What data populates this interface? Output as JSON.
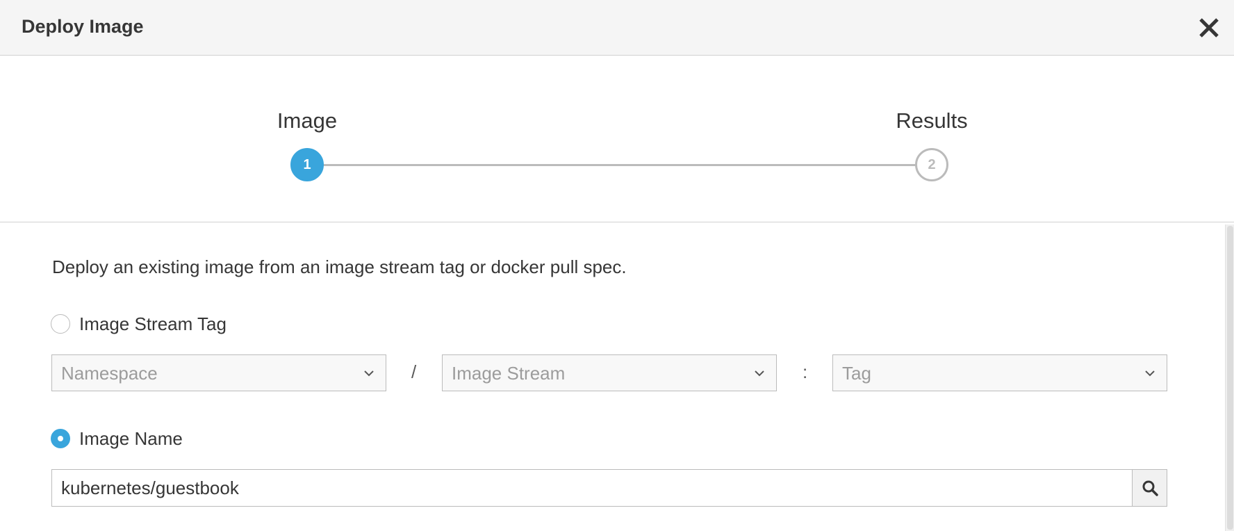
{
  "dialog": {
    "title": "Deploy Image",
    "close_icon": "close-icon"
  },
  "wizard": {
    "steps": [
      {
        "label": "Image",
        "number": "1",
        "state": "active"
      },
      {
        "label": "Results",
        "number": "2",
        "state": "inactive"
      }
    ]
  },
  "form": {
    "intro": "Deploy an existing image from an image stream tag or docker pull spec.",
    "image_stream_tag": {
      "label": "Image Stream Tag",
      "selected": false,
      "namespace_placeholder": "Namespace",
      "separator_slash": "/",
      "image_stream_placeholder": "Image Stream",
      "separator_colon": ":",
      "tag_placeholder": "Tag"
    },
    "image_name": {
      "label": "Image Name",
      "selected": true,
      "value": "kubernetes/guestbook",
      "search_icon": "search-icon"
    }
  },
  "colors": {
    "accent": "#39a5dc",
    "header_bg": "#f5f5f5",
    "border": "#bbbbbb",
    "text": "#363636"
  }
}
